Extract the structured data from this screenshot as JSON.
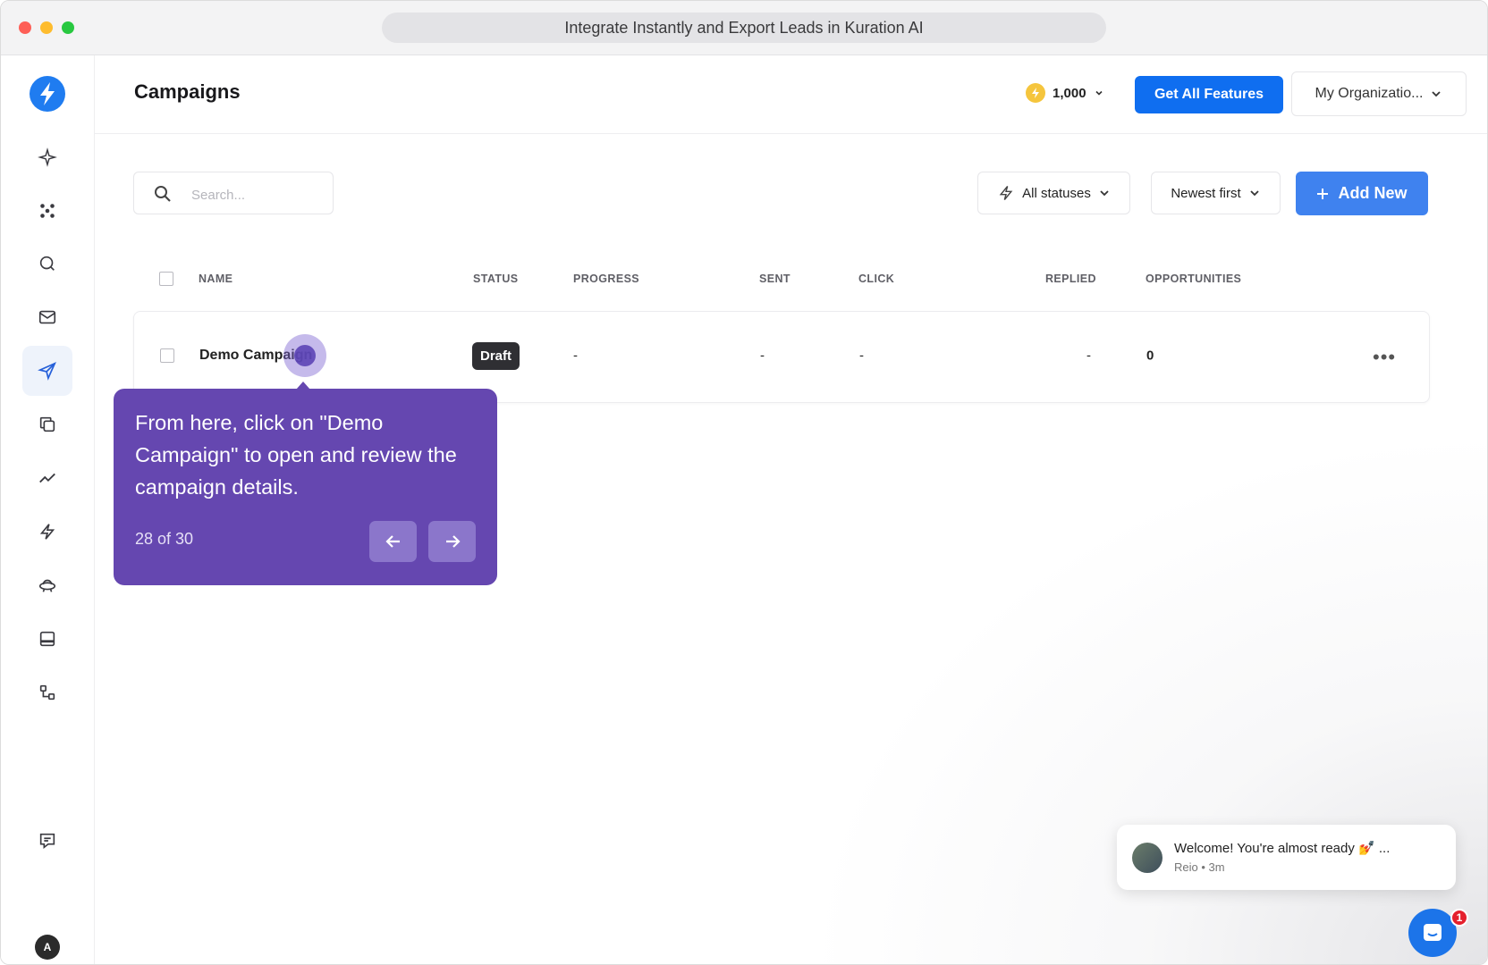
{
  "browser": {
    "tab_title": "Integrate Instantly and Export Leads in Kuration AI"
  },
  "sidebar": {
    "items": [
      {
        "icon": "sparkle-icon",
        "active": false
      },
      {
        "icon": "dots-cluster-icon",
        "active": false
      },
      {
        "icon": "search-icon",
        "active": false
      },
      {
        "icon": "mail-icon",
        "active": false
      },
      {
        "icon": "send-icon",
        "active": true
      },
      {
        "icon": "copy-icon",
        "active": false
      },
      {
        "icon": "analytics-icon",
        "active": false
      },
      {
        "icon": "lightning-icon",
        "active": false
      },
      {
        "icon": "ufo-icon",
        "active": false
      },
      {
        "icon": "inbox-icon",
        "active": false
      },
      {
        "icon": "integrations-icon",
        "active": false
      },
      {
        "icon": "feedback-icon",
        "active": false
      }
    ],
    "user_initial": "A"
  },
  "header": {
    "title": "Campaigns",
    "credits": "1,000",
    "features_button": "Get All Features",
    "organization": "My Organizatio..."
  },
  "toolbar": {
    "search_placeholder": "Search...",
    "status_filter": "All statuses",
    "sort": "Newest first",
    "add_new": "Add New"
  },
  "table": {
    "columns": [
      "NAME",
      "STATUS",
      "PROGRESS",
      "SENT",
      "CLICK",
      "REPLIED",
      "OPPORTUNITIES"
    ],
    "rows": [
      {
        "name": "Demo Campaign",
        "status": "Draft",
        "progress": "-",
        "sent": "-",
        "click": "-",
        "replied": "-",
        "opportunities": "0"
      }
    ]
  },
  "tooltip": {
    "text": "From here, click on \"Demo Campaign\" to open and review the campaign details.",
    "counter": "28 of 30"
  },
  "chat": {
    "message": "Welcome! You're almost ready 💅 ...",
    "meta": "Reio • 3m",
    "unread": "1"
  },
  "colors": {
    "primary": "#0f6ef0",
    "add_button": "#3f82ef",
    "tooltip": "#6547b0",
    "draft_badge": "#2f2f33"
  }
}
